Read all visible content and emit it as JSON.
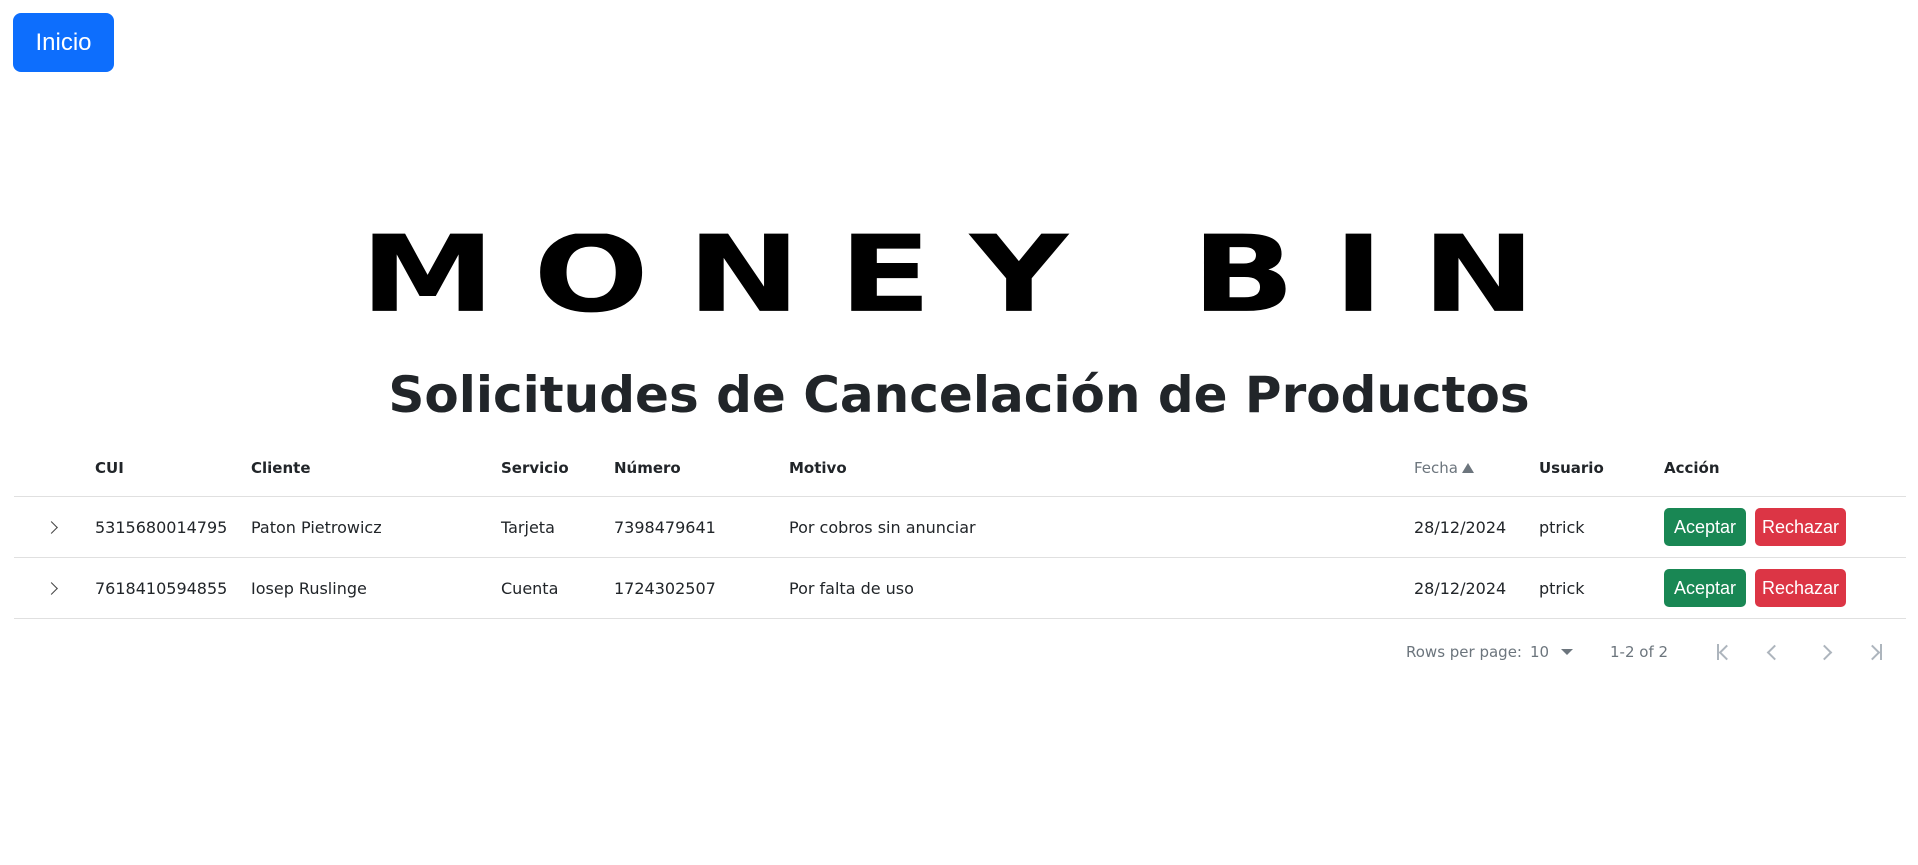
{
  "nav": {
    "home_label": "Inicio"
  },
  "logo": {
    "text": "MONEY BIN"
  },
  "page": {
    "title": "Solicitudes de Cancelación de Productos"
  },
  "table": {
    "columns": {
      "cui": "CUI",
      "cliente": "Cliente",
      "servicio": "Servicio",
      "numero": "Número",
      "motivo": "Motivo",
      "fecha": "Fecha",
      "usuario": "Usuario",
      "accion": "Acción"
    },
    "sorted_by": "Fecha",
    "sort_direction": "ascending",
    "rows": [
      {
        "cui": "5315680014795",
        "cliente": "Paton Pietrowicz",
        "servicio": "Tarjeta",
        "numero": "7398479641",
        "motivo": "Por cobros sin anunciar",
        "fecha": "28/12/2024",
        "usuario": "ptrick",
        "accept_label": "Aceptar",
        "reject_label": "Rechazar"
      },
      {
        "cui": "7618410594855",
        "cliente": "Iosep Ruslinge",
        "servicio": "Cuenta",
        "numero": "1724302507",
        "motivo": "Por falta de uso",
        "fecha": "28/12/2024",
        "usuario": "ptrick",
        "accept_label": "Aceptar",
        "reject_label": "Rechazar"
      }
    ]
  },
  "pagination": {
    "rows_per_page_label": "Rows per page:",
    "rows_per_page_value": "10",
    "range_text": "1-2 of 2"
  },
  "icons": {
    "expand": "chevron-right-icon",
    "sort": "sort-up-icon",
    "first_page": "first-page-icon",
    "prev_page": "chevron-left-icon",
    "next_page": "chevron-right-icon",
    "last_page": "last-page-icon"
  },
  "colors": {
    "primary": "#0d6efd",
    "success": "#198754",
    "danger": "#dc3545"
  }
}
